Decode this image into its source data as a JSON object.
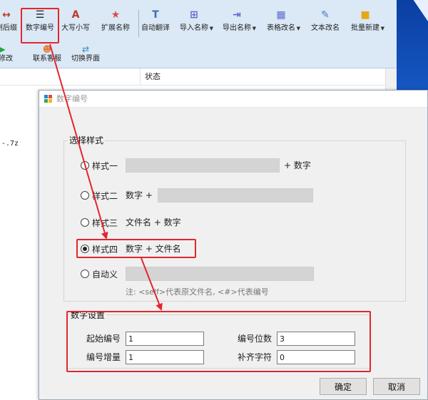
{
  "toolbar": {
    "top": [
      {
        "id": "remove-suffix",
        "label": "删后缀",
        "icon": "↔",
        "color": "#c0392b",
        "caret": false
      },
      {
        "id": "number-naming",
        "label": "数字编号",
        "icon": "☰",
        "color": "#222222",
        "caret": false
      },
      {
        "id": "case-convert",
        "label": "大写小写",
        "icon": "A",
        "color": "#c0392b",
        "caret": false
      },
      {
        "id": "extend-name",
        "label": "扩展名称",
        "icon": "★",
        "color": "#d94a4a",
        "caret": false
      },
      {
        "id": "auto-translate",
        "label": "自动翻译",
        "icon": "T",
        "color": "#3a6fb0",
        "caret": false
      },
      {
        "id": "import-name",
        "label": "导入名称",
        "icon": "⊞",
        "color": "#5a6ad0",
        "caret": true
      },
      {
        "id": "export-name",
        "label": "导出名称",
        "icon": "⇥",
        "color": "#5a6ad0",
        "caret": true
      },
      {
        "id": "table-rename",
        "label": "表格改名",
        "icon": "▦",
        "color": "#5a6ad0",
        "caret": true
      },
      {
        "id": "text-rename",
        "label": "文本改名",
        "icon": "✎",
        "color": "#4a78c8",
        "caret": false
      },
      {
        "id": "batch-new",
        "label": "批量新建",
        "icon": "■",
        "color": "#e6a817",
        "caret": true
      }
    ],
    "bottom": [
      {
        "id": "execute-rename",
        "label": "行修改",
        "icon": "▶",
        "color": "#27a745"
      },
      {
        "id": "contact-support",
        "label": "联系客服",
        "icon": "☻",
        "color": "#e07b39"
      },
      {
        "id": "switch-ui",
        "label": "切换界面",
        "icon": "⇄",
        "color": "#2e8bc0"
      }
    ]
  },
  "list": {
    "status_header": "状态",
    "row_text": "-.7z"
  },
  "dialog": {
    "title": "数字编号",
    "style_group": {
      "caption": "选择样式",
      "options": [
        {
          "id": "style-1",
          "label": "样式一",
          "checked": false
        },
        {
          "id": "style-2",
          "label": "样式二",
          "checked": false
        },
        {
          "id": "style-3",
          "label": "样式三",
          "checked": false
        },
        {
          "id": "style-4",
          "label": "样式四",
          "checked": true
        },
        {
          "id": "custom",
          "label": "自动义",
          "checked": false
        }
      ],
      "style1_suffix": "+ 数字",
      "style2_prefix": "数字 +",
      "style3_desc": "文件名 + 数字",
      "style4_desc": "数字 + 文件名",
      "note": "注: <self>代表原文件名, <#>代表编号"
    },
    "number_group": {
      "caption": "数字设置",
      "start_label": "起始编号",
      "start_value": "1",
      "digits_label": "编号位数",
      "digits_value": "3",
      "step_label": "编号增量",
      "step_value": "1",
      "pad_label": "补齐字符",
      "pad_value": "0"
    },
    "ok_label": "确定",
    "cancel_label": "取消"
  },
  "annotation_color": "#e3262e"
}
